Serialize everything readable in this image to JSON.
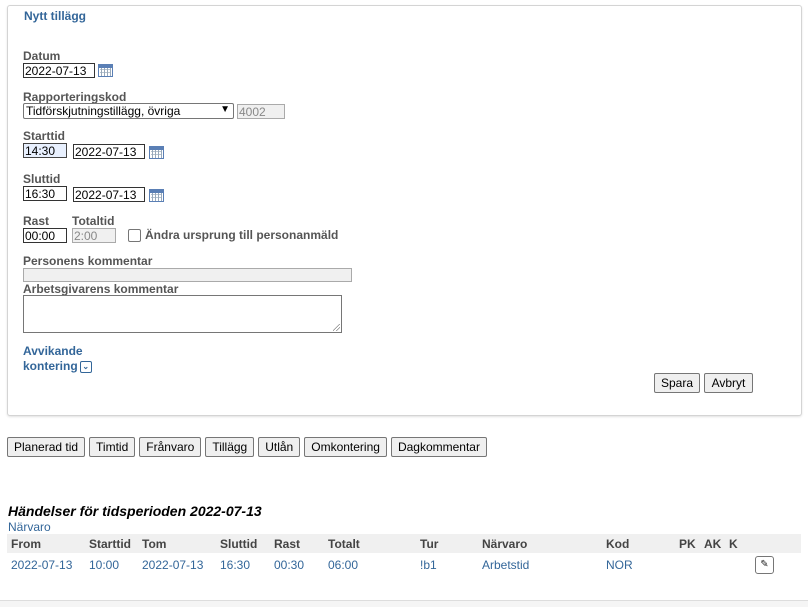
{
  "form": {
    "title": "Nytt tillägg",
    "datum": {
      "label": "Datum",
      "value": "2022-07-13"
    },
    "rapporteringskod": {
      "label": "Rapporteringskod",
      "selected": "Tidförskjutningstillägg, övriga",
      "code": "4002"
    },
    "starttid": {
      "label": "Starttid",
      "time": "14:30",
      "date": "2022-07-13"
    },
    "sluttid": {
      "label": "Sluttid",
      "time": "16:30",
      "date": "2022-07-13"
    },
    "rast": {
      "label": "Rast",
      "value": "00:00"
    },
    "totaltid": {
      "label": "Totaltid",
      "value": "2:00"
    },
    "andra_ursprung": {
      "label": "Ändra ursprung till personanmäld",
      "checked": false
    },
    "personens_kommentar": {
      "label": "Personens kommentar",
      "value": ""
    },
    "arbetsgivarens_kommentar": {
      "label": "Arbetsgivarens kommentar",
      "value": ""
    },
    "avvikande_kontering": {
      "line1": "Avvikande",
      "line2": "kontering"
    },
    "save_label": "Spara",
    "cancel_label": "Avbryt"
  },
  "tabs": [
    "Planerad tid",
    "Timtid",
    "Frånvaro",
    "Tillägg",
    "Utlån",
    "Omkontering",
    "Dagkommentar"
  ],
  "events": {
    "title": "Händelser för tidsperioden 2022-07-13",
    "subtitle": "Närvaro",
    "columns": [
      "From",
      "Starttid",
      "Tom",
      "Sluttid",
      "Rast",
      "Totalt",
      "Tur",
      "Närvaro",
      "Kod",
      "PK",
      "AK",
      "K"
    ],
    "rows": [
      [
        "2022-07-13",
        "10:00",
        "2022-07-13",
        "16:30",
        "00:30",
        "06:00",
        "!b1",
        "Arbetstid",
        "NOR",
        "",
        "",
        ""
      ]
    ]
  },
  "icons": {
    "calendar": "calendar-icon",
    "expand": "chevron-down-icon",
    "edit": "pencil-icon"
  }
}
